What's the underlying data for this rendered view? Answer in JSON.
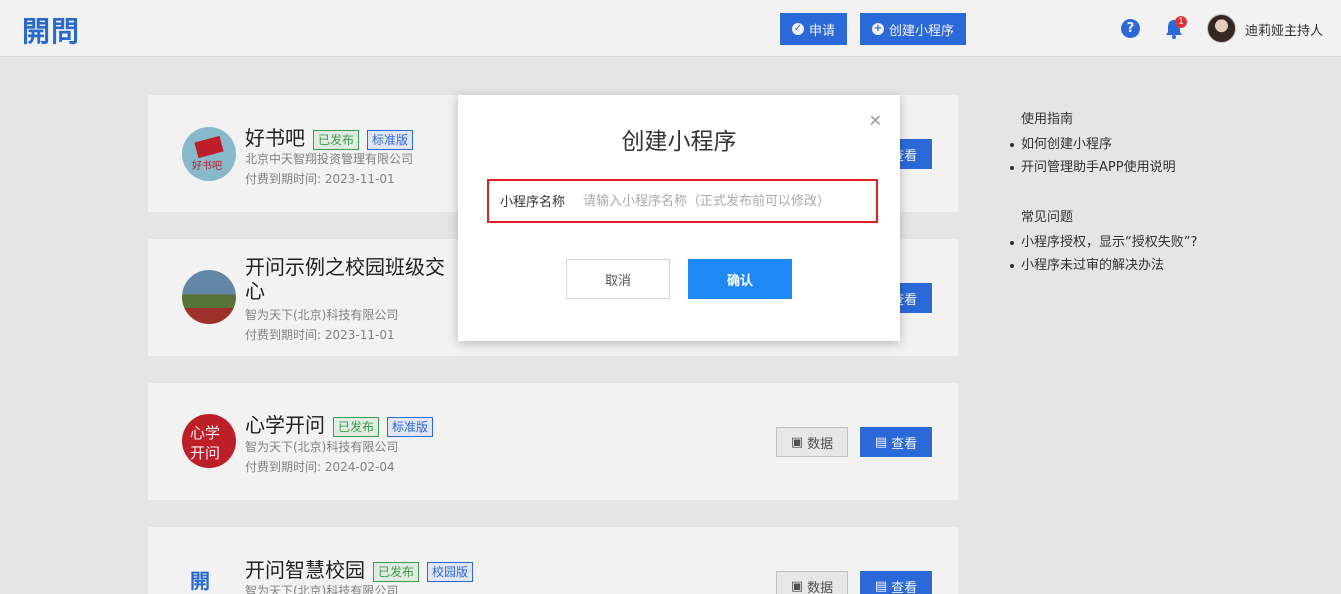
{
  "header": {
    "logo": "開問",
    "apply_label": "申请",
    "create_label": "创建小程序",
    "help_icon": "question-circle-icon",
    "bell_badge": "1",
    "username": "迪莉娅主持人"
  },
  "cards": [
    {
      "title": "好书吧",
      "status": "已发布",
      "edition": "标准版",
      "company": "北京中天智翔投资管理有限公司",
      "expiry": "付费到期时间:   2023-11-01",
      "view_label": "查看"
    },
    {
      "title": "开问示例之校园班级交",
      "title_line2": "心",
      "company": "智为天下(北京)科技有限公司",
      "expiry": "付费到期时间:   2023-11-01",
      "view_label": "查看"
    },
    {
      "title": "心学开问",
      "status": "已发布",
      "edition": "标准版",
      "company": "智为天下(北京)科技有限公司",
      "expiry": "付费到期时间:   2024-02-04",
      "data_label": "数据",
      "view_label": "查看"
    },
    {
      "title": "开问智慧校园",
      "status": "已发布",
      "edition": "校园版",
      "company": "智为天下(北京)科技有限公司",
      "data_label": "数据",
      "view_label": "查看"
    }
  ],
  "guide": {
    "heading": "使用指南",
    "items": [
      "如何创建小程序",
      "开问管理助手APP使用说明"
    ],
    "faq_heading": "常见问题",
    "faq_items": [
      "小程序授权，显示“授权失败”?",
      "小程序未过审的解决办法"
    ]
  },
  "modal": {
    "title": "创建小程序",
    "field_label": "小程序名称",
    "field_placeholder": "请输入小程序名称（正式发布前可以修改）",
    "field_value": "",
    "cancel_label": "取消",
    "confirm_label": "确认",
    "highlight_color": "#e02020"
  },
  "colors": {
    "primary": "#2f6fe4",
    "confirm": "#1e88f5",
    "published_tag": "#3aa84e"
  }
}
